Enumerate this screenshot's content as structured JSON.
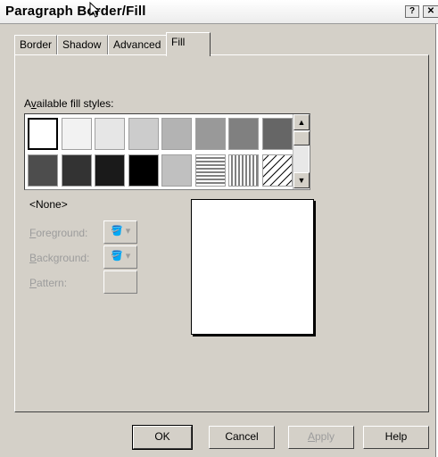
{
  "window": {
    "title": "Paragraph Border/Fill",
    "help_glyph": "?",
    "close_glyph": "✕"
  },
  "tabs": [
    {
      "label": "Border",
      "active": false
    },
    {
      "label": "Shadow",
      "active": false
    },
    {
      "label": "Advanced",
      "active": false
    },
    {
      "label": "Fill",
      "active": true
    }
  ],
  "fill": {
    "available_label": "Available fill styles:",
    "available_mnemonic": "v",
    "selected_name": "<None>",
    "swatches": [
      {
        "name": "none",
        "color": "#ffffff",
        "selected": true
      },
      {
        "name": "gray-5",
        "color": "#f2f2f2"
      },
      {
        "name": "gray-10",
        "color": "#e6e6e6"
      },
      {
        "name": "gray-20",
        "color": "#cccccc"
      },
      {
        "name": "gray-30",
        "color": "#b3b3b3"
      },
      {
        "name": "gray-40",
        "color": "#999999"
      },
      {
        "name": "gray-50",
        "color": "#808080"
      },
      {
        "name": "gray-60",
        "color": "#666666"
      },
      {
        "name": "gray-70",
        "color": "#4d4d4d"
      },
      {
        "name": "gray-80",
        "color": "#333333"
      },
      {
        "name": "gray-90",
        "color": "#1a1a1a"
      },
      {
        "name": "black",
        "color": "#000000"
      },
      {
        "name": "gray-25",
        "color": "#c0c0c0"
      },
      {
        "name": "horizontal-lines",
        "color": "pattern-h"
      },
      {
        "name": "vertical-lines",
        "color": "pattern-v"
      },
      {
        "name": "diagonal-lines",
        "color": "pattern-d"
      }
    ],
    "foreground_label": "Foreground:",
    "background_label": "Background:",
    "pattern_label": "Pattern:",
    "dropdown_glyph": "▾"
  },
  "buttons": {
    "ok": "OK",
    "cancel": "Cancel",
    "apply": "Apply",
    "help": "Help"
  }
}
